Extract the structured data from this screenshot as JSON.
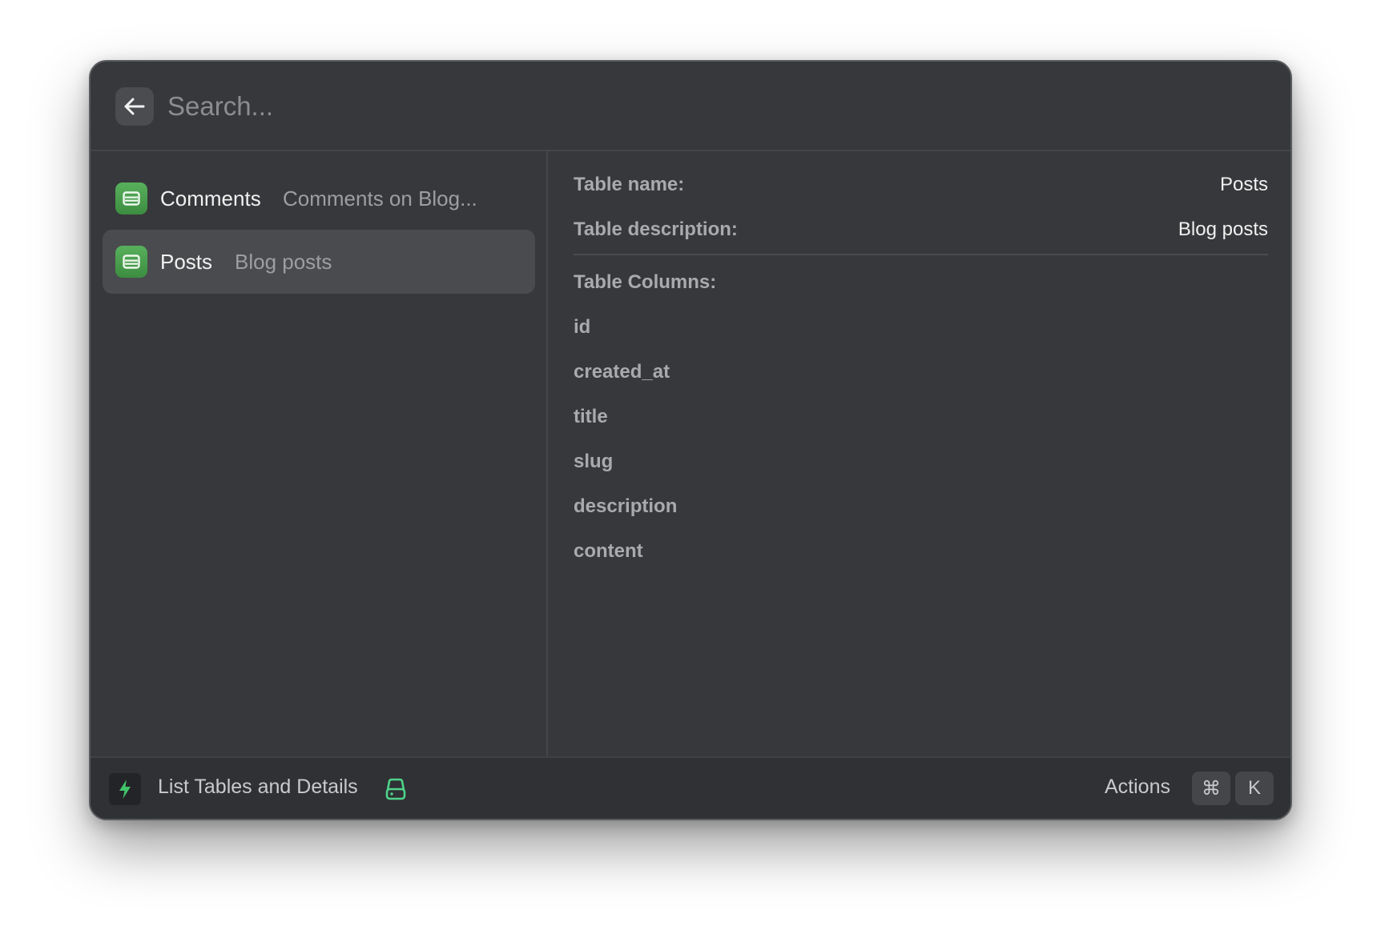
{
  "search": {
    "placeholder": "Search...",
    "back_icon": "arrow-left-icon"
  },
  "sidebar": {
    "items": [
      {
        "title": "Comments",
        "subtitle": "Comments on Blog...",
        "icon": "table-icon",
        "selected": false
      },
      {
        "title": "Posts",
        "subtitle": "Blog posts",
        "icon": "table-icon",
        "selected": true
      }
    ]
  },
  "detail": {
    "table_name_label": "Table name:",
    "table_name_value": "Posts",
    "table_description_label": "Table description:",
    "table_description_value": "Blog posts",
    "columns_label": "Table Columns:",
    "columns": [
      "id",
      "created_at",
      "title",
      "slug",
      "description",
      "content"
    ]
  },
  "footer": {
    "command_icon": "bolt-icon",
    "command_title": "List Tables and Details",
    "extension_icon": "drive-icon",
    "actions_label": "Actions",
    "shortcut_keys": [
      "⌘",
      "K"
    ]
  },
  "colors": {
    "accent_green": "#4ea852",
    "bolt_green": "#3fc46a",
    "drive_green": "#4fd38a",
    "window_bg": "#37383b",
    "selected_bg": "#4a4b4e"
  }
}
